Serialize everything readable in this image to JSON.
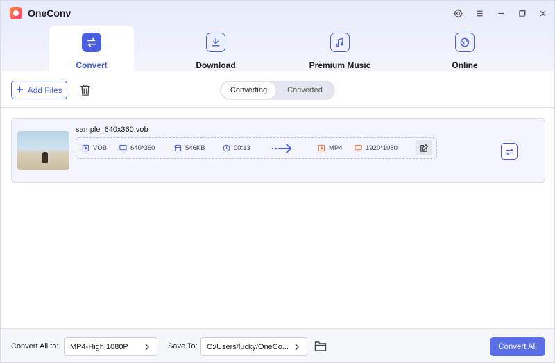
{
  "app": {
    "title": "OneConv"
  },
  "tabs": [
    {
      "label": "Convert",
      "active": true
    },
    {
      "label": "Download",
      "active": false
    },
    {
      "label": "Premium Music",
      "active": false
    },
    {
      "label": "Online",
      "active": false
    }
  ],
  "toolbar": {
    "add_files_label": "Add Files",
    "segment": {
      "converting": "Converting",
      "converted": "Converted",
      "selected": "Converting"
    }
  },
  "file": {
    "name": "sample_640x360.vob",
    "source": {
      "format": "VOB",
      "resolution": "640*360",
      "size": "546KB",
      "duration": "00:13"
    },
    "target": {
      "format": "MP4",
      "resolution": "1920*1080"
    }
  },
  "footer": {
    "convert_all_to_label": "Convert All to:",
    "convert_all_to_value": "MP4-High 1080P",
    "save_to_label": "Save To:",
    "save_to_value": "C:/Users/lucky/OneCo...",
    "convert_all_button": "Convert All"
  },
  "colors": {
    "accent": "#4a5fe0",
    "button": "#5a6ee8",
    "target_format": "#f07a3a"
  }
}
